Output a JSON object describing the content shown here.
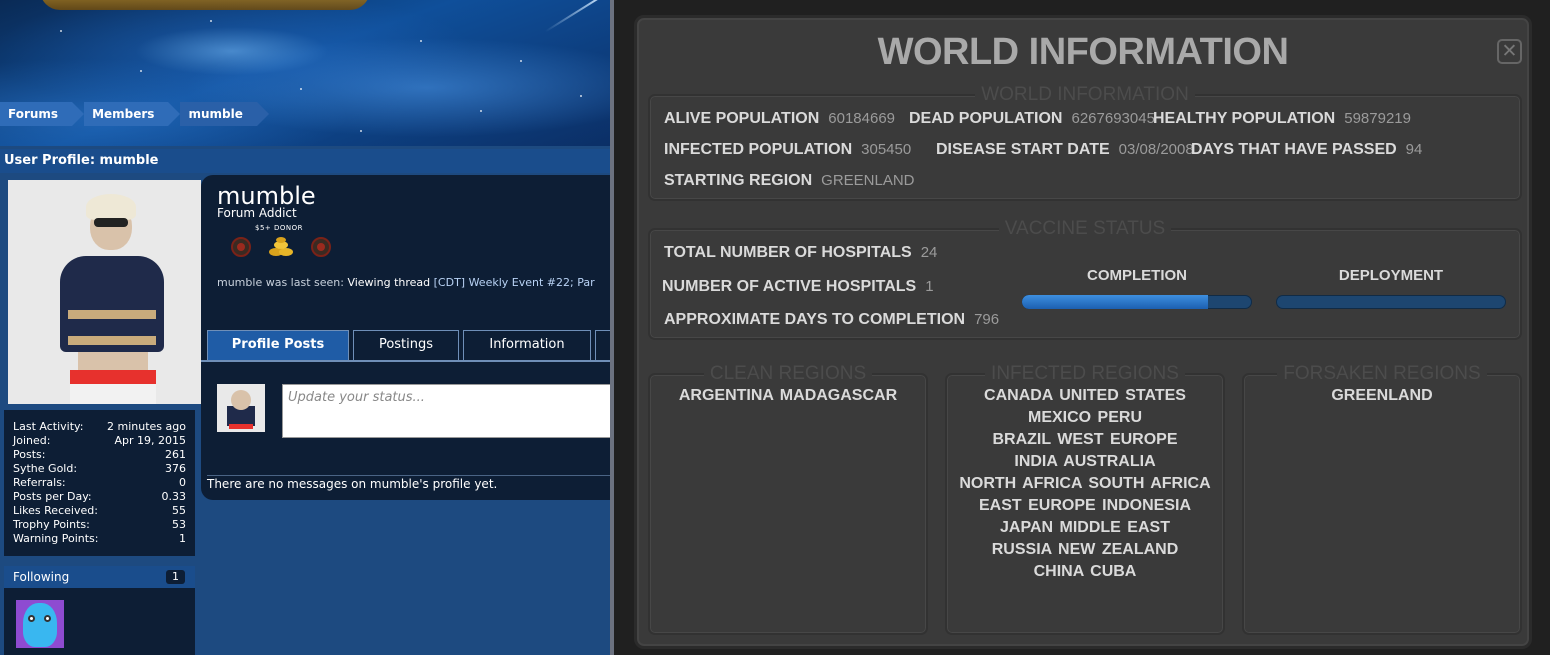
{
  "forum": {
    "breadcrumb": [
      "Forums",
      "Members",
      "mumble"
    ],
    "profile_header": "User Profile: mumble",
    "username": "mumble",
    "user_title": "Forum Addict",
    "donor_label": "$5+ DONOR",
    "last_seen": {
      "prefix": "mumble was last seen:",
      "action": "Viewing thread",
      "thread": "[CDT] Weekly Event #22; Par"
    },
    "tabs": [
      "Profile Posts",
      "Postings",
      "Information",
      ""
    ],
    "status_placeholder": "Update your status...",
    "no_messages": "There are no messages on mumble's profile yet.",
    "stats": [
      {
        "label": "Last Activity:",
        "value": "2 minutes ago"
      },
      {
        "label": "Joined:",
        "value": "Apr 19, 2015"
      },
      {
        "label": "Posts:",
        "value": "261"
      },
      {
        "label": "Sythe Gold:",
        "value": "376"
      },
      {
        "label": "Referrals:",
        "value": "0"
      },
      {
        "label": "Posts per Day:",
        "value": "0.33"
      },
      {
        "label": "Likes Received:",
        "value": "55"
      },
      {
        "label": "Trophy Points:",
        "value": "53"
      },
      {
        "label": "Warning Points:",
        "value": "1"
      }
    ],
    "following": {
      "label": "Following",
      "count": "1"
    }
  },
  "game": {
    "title": "WORLD INFORMATION",
    "close_icon": "close-icon",
    "world_panel": {
      "legend": "WORLD INFORMATION",
      "alive_label": "ALIVE POPULATION",
      "alive_value": "60184669",
      "dead_label": "DEAD POPULATION",
      "dead_value": "6267693045",
      "healthy_label": "HEALTHY POPULATION",
      "healthy_value": "59879219",
      "infected_label": "INFECTED POPULATION",
      "infected_value": "305450",
      "start_label": "DISEASE START DATE",
      "start_value": "03/08/2008",
      "days_label": "DAYS THAT HAVE PASSED",
      "days_value": "94",
      "region_label": "STARTING REGION",
      "region_value": "GREENLAND"
    },
    "vaccine_panel": {
      "legend": "VACCINE STATUS",
      "hospitals_label": "TOTAL NUMBER OF HOSPITALS",
      "hospitals_value": "24",
      "active_label": "NUMBER OF ACTIVE HOSPITALS",
      "active_value": "1",
      "approx_label": "APPROXIMATE DAYS TO COMPLETION",
      "approx_value": "796",
      "completion_label": "COMPLETION",
      "completion_fraction": 0.81,
      "deployment_label": "DEPLOYMENT",
      "deployment_fraction": 0.0
    },
    "clean_panel": {
      "legend": "CLEAN REGIONS",
      "lines": [
        "ARGENTINA  MADAGASCAR"
      ]
    },
    "infected_panel": {
      "legend": "INFECTED REGIONS",
      "lines": [
        "CANADA  UNITED STATES",
        "MEXICO  PERU",
        "BRAZIL  WEST EUROPE",
        "INDIA  AUSTRALIA",
        "NORTH AFRICA  SOUTH AFRICA",
        "EAST EUROPE  INDONESIA",
        "JAPAN  MIDDLE EAST",
        "RUSSIA  NEW ZEALAND",
        "CHINA  CUBA"
      ]
    },
    "forsaken_panel": {
      "legend": "FORSAKEN REGIONS",
      "lines": [
        "GREENLAND"
      ]
    }
  }
}
